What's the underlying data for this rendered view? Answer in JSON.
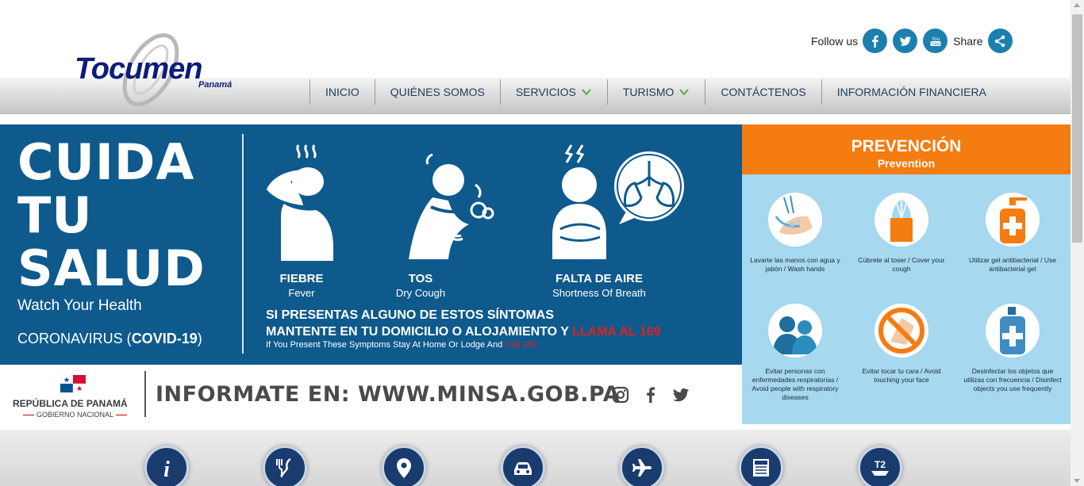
{
  "header": {
    "logo_text": "Tocumen",
    "logo_sub": "Panamá",
    "follow_label": "Follow us",
    "share_label": "Share",
    "social_icons": [
      "facebook-icon",
      "twitter-icon",
      "youtube-icon",
      "share-icon"
    ],
    "nav": [
      {
        "label": "INICIO",
        "dropdown": false
      },
      {
        "label": "QUIÉNES SOMOS",
        "dropdown": false
      },
      {
        "label": "SERVICIOS",
        "dropdown": true
      },
      {
        "label": "TURISMO",
        "dropdown": true
      },
      {
        "label": "CONTÁCTENOS",
        "dropdown": false
      },
      {
        "label": "INFORMACIÓN FINANCIERA",
        "dropdown": false
      }
    ]
  },
  "banner": {
    "headline_1": "CUIDA",
    "headline_2": "TU",
    "headline_3": "SALUD",
    "headline_en": "Watch Your Health",
    "corona_prefix": "CORONAVIRUS (",
    "corona_bold": "COVID-19",
    "corona_suffix": ")",
    "symptoms": [
      {
        "title": "FIEBRE",
        "subtitle": "Fever"
      },
      {
        "title": "TOS",
        "subtitle": "Dry Cough"
      },
      {
        "title": "FALTA DE AIRE",
        "subtitle": "Shortness Of Breath"
      }
    ],
    "message_line1": "SI PRESENTAS ALGUNO DE ESTOS SÍNTOMAS",
    "message_line2": "MANTENTE EN TU DOMICILIO O ALOJAMIENTO Y",
    "message_call": "LLAMA AL 169",
    "message_en": "If You Present These Symptoms Stay At Home Or Lodge And",
    "message_en_call": "Call 169",
    "republic": "REPÚBLICA DE PANAMÁ",
    "government": "GOBIERNO NACIONAL",
    "informate": "INFORMATE EN: WWW.MINSA.GOB.PA",
    "strip_icons": [
      "instagram-icon",
      "facebook-icon",
      "twitter-icon"
    ],
    "prevention_title": "PREVENCIÓN",
    "prevention_subtitle": "Prevention",
    "prevention": [
      {
        "caption": "Lavarte las manos con agua y jabón / Wash hands",
        "icon": "hand-wash-icon"
      },
      {
        "caption": "Cúbrete al toser / Cover your cough",
        "icon": "tissue-icon"
      },
      {
        "caption": "Utilizar gel antibacterial / Use antibacterial gel",
        "icon": "sanitizer-icon"
      },
      {
        "caption": "Evitar personas con enfermedades respiratorias / Avoid people with respiratory diseases",
        "icon": "people-icon"
      },
      {
        "caption": "Evitar tocar tu cara / Avoid touching your face",
        "icon": "no-touch-face-icon"
      },
      {
        "caption": "Desinfectar los objetos que utilizas con frecuencia / Disinfect objects you use frequently",
        "icon": "disinfect-icon"
      }
    ]
  },
  "bottom_icons": [
    "info-icon",
    "food-icon",
    "location-icon",
    "car-icon",
    "airplane-icon",
    "news-icon",
    "t2-icon"
  ],
  "colors": {
    "primary": "#0e5a8c",
    "orange": "#f57c10",
    "light_blue": "#a6d8ef",
    "social": "#1d7fae",
    "red": "#e02020"
  }
}
